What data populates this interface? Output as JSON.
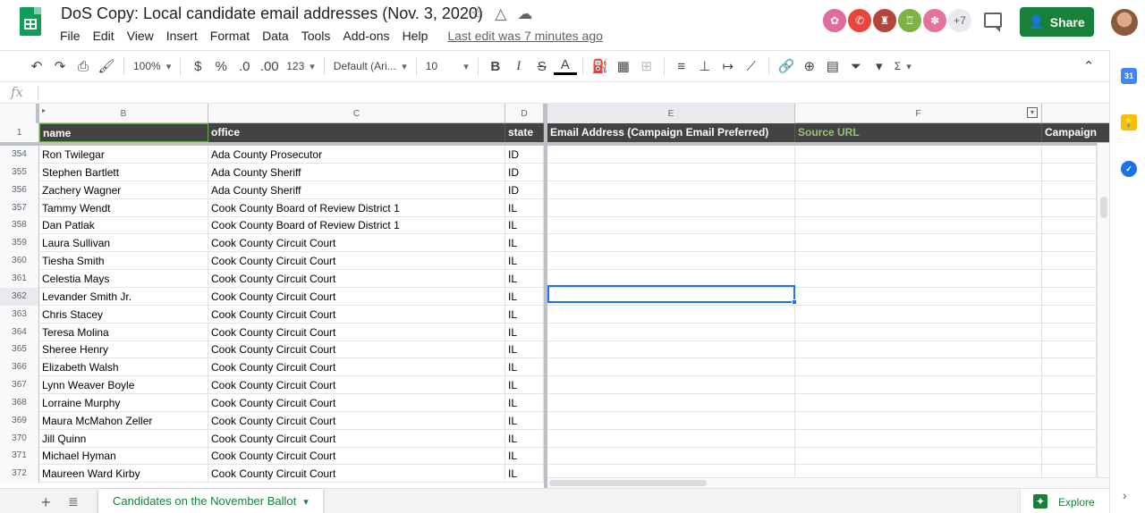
{
  "doc": {
    "title": "DoS Copy: Local candidate email addresses (Nov. 3, 2020)",
    "last_edit": "Last edit was 7 minutes ago"
  },
  "menu": [
    "File",
    "Edit",
    "View",
    "Insert",
    "Format",
    "Data",
    "Tools",
    "Add-ons",
    "Help"
  ],
  "collaborators": {
    "more_count": "+7",
    "colors": [
      "#e06c9f",
      "#e8453c",
      "#b5443c",
      "#7cb342",
      "#e57399"
    ]
  },
  "share_label": "Share",
  "toolbar": {
    "zoom": "100%",
    "currency": "$",
    "percent": "%",
    "dec_decrease": ".0",
    "dec_increase": ".00",
    "more_formats": "123",
    "font": "Default (Ari...",
    "font_size": "10",
    "bold": "B",
    "italic": "I",
    "strike": "S",
    "text_color": "A",
    "sum": "Σ"
  },
  "formula_bar": {
    "fx": "fx",
    "value": ""
  },
  "columns": [
    "B",
    "C",
    "D",
    "E",
    "F"
  ],
  "header_row": {
    "row_number": "1",
    "cells": [
      "name",
      "office",
      "state",
      "Email Address (Campaign Email Preferred)",
      "Source URL",
      "Campaign"
    ]
  },
  "rows": [
    {
      "n": "354",
      "name": "Ron Twilegar",
      "office": "Ada County Prosecutor",
      "state": "ID"
    },
    {
      "n": "355",
      "name": "Stephen Bartlett",
      "office": "Ada County Sheriff",
      "state": "ID"
    },
    {
      "n": "356",
      "name": "Zachery Wagner",
      "office": "Ada County Sheriff",
      "state": "ID"
    },
    {
      "n": "357",
      "name": "Tammy Wendt",
      "office": "Cook County Board of Review District 1",
      "state": "IL"
    },
    {
      "n": "358",
      "name": "Dan Patlak",
      "office": "Cook County Board of Review District 1",
      "state": "IL"
    },
    {
      "n": "359",
      "name": "Laura Sullivan",
      "office": "Cook County Circuit Court",
      "state": "IL"
    },
    {
      "n": "360",
      "name": "Tiesha Smith",
      "office": "Cook County Circuit Court",
      "state": "IL"
    },
    {
      "n": "361",
      "name": "Celestia Mays",
      "office": "Cook County Circuit Court",
      "state": "IL"
    },
    {
      "n": "362",
      "name": "Levander Smith Jr.",
      "office": "Cook County Circuit Court",
      "state": "IL"
    },
    {
      "n": "363",
      "name": "Chris Stacey",
      "office": "Cook County Circuit Court",
      "state": "IL"
    },
    {
      "n": "364",
      "name": "Teresa Molina",
      "office": "Cook County Circuit Court",
      "state": "IL"
    },
    {
      "n": "365",
      "name": "Sheree Henry",
      "office": "Cook County Circuit Court",
      "state": "IL"
    },
    {
      "n": "366",
      "name": "Elizabeth Walsh",
      "office": "Cook County Circuit Court",
      "state": "IL"
    },
    {
      "n": "367",
      "name": "Lynn Weaver Boyle",
      "office": "Cook County Circuit Court",
      "state": "IL"
    },
    {
      "n": "368",
      "name": "Lorraine Murphy",
      "office": "Cook County Circuit Court",
      "state": "IL"
    },
    {
      "n": "369",
      "name": "Maura McMahon Zeller",
      "office": "Cook County Circuit Court",
      "state": "IL"
    },
    {
      "n": "370",
      "name": "Jill Quinn",
      "office": "Cook County Circuit Court",
      "state": "IL"
    },
    {
      "n": "371",
      "name": "Michael Hyman",
      "office": "Cook County Circuit Court",
      "state": "IL"
    },
    {
      "n": "372",
      "name": "Maureen Ward Kirby",
      "office": "Cook County Circuit Court",
      "state": "IL"
    }
  ],
  "selected_row": "362",
  "sheet_tab": "Candidates on the November Ballot",
  "explore_label": "Explore",
  "side_panel": {
    "calendar_day": "31"
  },
  "colors": {
    "accent_green": "#188038",
    "selection_blue": "#1a73e8",
    "header_dark": "#434343"
  }
}
